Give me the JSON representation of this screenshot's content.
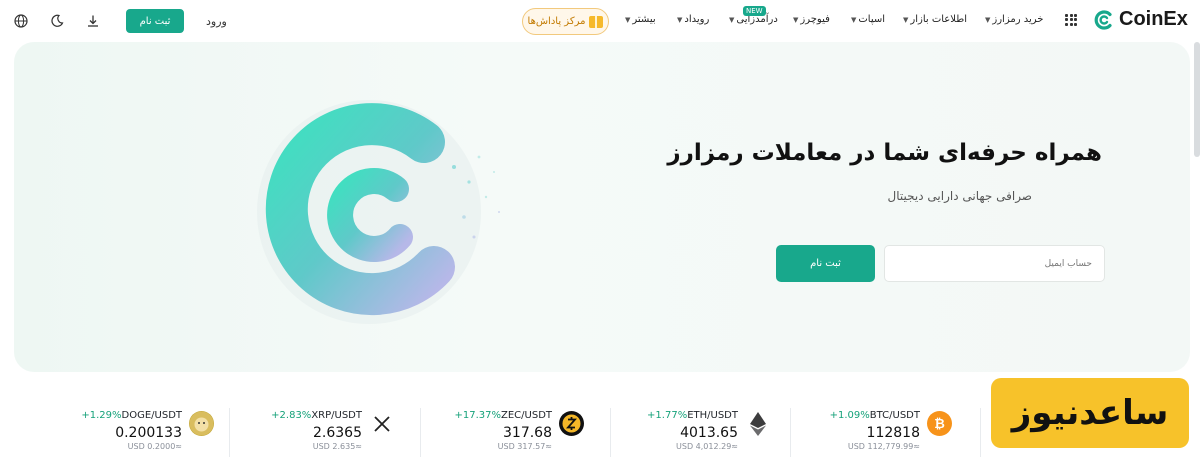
{
  "nav": {
    "logo_text": "CoinEx",
    "menu": [
      {
        "label": "خرید رمزارز",
        "dropdown": true
      },
      {
        "label": "اطلاعات بازار",
        "dropdown": true
      },
      {
        "label": "اسپات",
        "dropdown": true
      },
      {
        "label": "فیوچرز",
        "dropdown": true
      },
      {
        "label": "درآمدزایی",
        "dropdown": true,
        "badge": "NEW"
      },
      {
        "label": "رویداد",
        "dropdown": true
      },
      {
        "label": "بیشتر",
        "dropdown": true
      }
    ],
    "rewards_label": "مرکز پاداش‌ها",
    "login_label": "ورود",
    "signup_label": "ثبت نام",
    "icons": [
      "grid-icon",
      "download-icon",
      "moon-icon",
      "globe-icon",
      "gift-icon"
    ]
  },
  "hero": {
    "title": "همراه حرفه‌ای شما در معاملات رمزارز",
    "subtitle": "صرافی جهانی دارایی دیجیتال",
    "email_placeholder": "حساب ایمیل",
    "signup_label": "ثبت نام"
  },
  "tickers": [
    {
      "pair": "BTC/USDT",
      "change": "+1.09%",
      "price": "112818",
      "usd": "USD 112,779.99≈",
      "icon": "bitcoin-icon",
      "color": "#f7931a"
    },
    {
      "pair": "ETH/USDT",
      "change": "+1.77%",
      "price": "4013.65",
      "usd": "USD 4,012.29≈",
      "icon": "ethereum-icon",
      "color": "#3c3c3d"
    },
    {
      "pair": "ZEC/USDT",
      "change": "+17.37%",
      "price": "317.68",
      "usd": "USD 317.57≈",
      "icon": "zcash-icon",
      "color": "#111111"
    },
    {
      "pair": "XRP/USDT",
      "change": "+2.83%",
      "price": "2.6365",
      "usd": "USD 2.635≈",
      "icon": "xrp-icon",
      "color": "#222222"
    },
    {
      "pair": "DOGE/USDT",
      "change": "+1.29%",
      "price": "0.200133",
      "usd": "USD 0.2000≈",
      "icon": "doge-icon",
      "color": "#c2a633"
    }
  ],
  "watermark": "ساعدنیوز",
  "colors": {
    "accent": "#18a88c",
    "positive": "#16a27a",
    "rewards": "#c27a00",
    "watermark_bg": "#f7c22a"
  }
}
